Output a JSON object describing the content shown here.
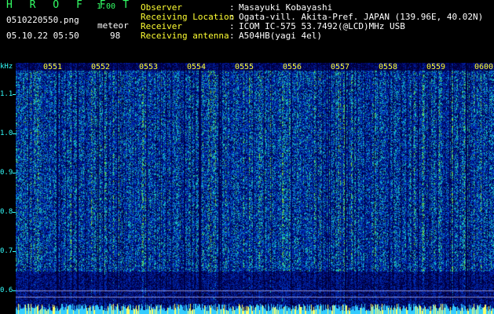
{
  "header": {
    "brand": "H R O F F T",
    "version": "1.00",
    "filename": "0510220550.png",
    "meteor_label": "meteor",
    "datetime": "05.10.22 05:50",
    "meteor_count": "98"
  },
  "info": [
    {
      "label": "Observer",
      "value": "Masayuki Kobayashi"
    },
    {
      "label": "Receiving Location",
      "value": "Ogata-vill. Akita-Pref. JAPAN (139.96E, 40.02N)"
    },
    {
      "label": "Receiver",
      "value": "ICOM IC-575 53.7492(@LCD)MHz USB"
    },
    {
      "label": "Receiving antenna",
      "value": "A504HB(yagi 4el)"
    }
  ],
  "axis": {
    "unit": "kHz",
    "ticks": [
      {
        "label": "1.1",
        "value": 1.1
      },
      {
        "label": "1.0",
        "value": 1.0
      },
      {
        "label": "0.9",
        "value": 0.9
      },
      {
        "label": "0.8",
        "value": 0.8
      },
      {
        "label": "0.7",
        "value": 0.7
      },
      {
        "label": "0.6",
        "value": 0.6
      }
    ]
  },
  "time_labels": [
    "0551",
    "0552",
    "0553",
    "0554",
    "0555",
    "0556",
    "0557",
    "0558",
    "0559",
    "0600"
  ]
}
